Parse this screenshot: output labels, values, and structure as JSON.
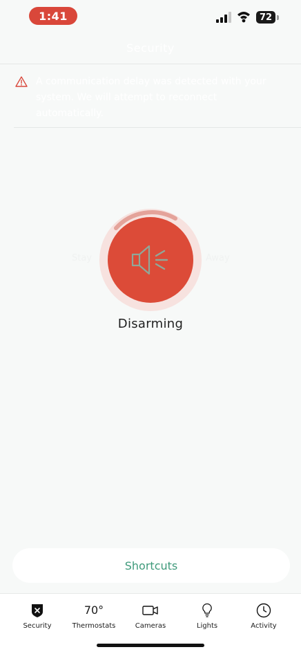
{
  "status_bar": {
    "time": "1:41",
    "battery": "72"
  },
  "header": {
    "title": "Security"
  },
  "alert": {
    "text": "A communication delay was detected with your system. We will attempt to reconnect automatically."
  },
  "security": {
    "state_label": "Disarming",
    "icon": "speaker-icon",
    "side_left": "Stay",
    "side_right": "Away",
    "accent": "#dc4b38"
  },
  "shortcuts": {
    "label": "Shortcuts"
  },
  "tabs": [
    {
      "label": "Security",
      "icon": "shield-x-icon"
    },
    {
      "label": "Thermostats",
      "value": "70°"
    },
    {
      "label": "Cameras",
      "icon": "camera-icon"
    },
    {
      "label": "Lights",
      "icon": "lightbulb-icon"
    },
    {
      "label": "Activity",
      "icon": "clock-icon"
    }
  ]
}
